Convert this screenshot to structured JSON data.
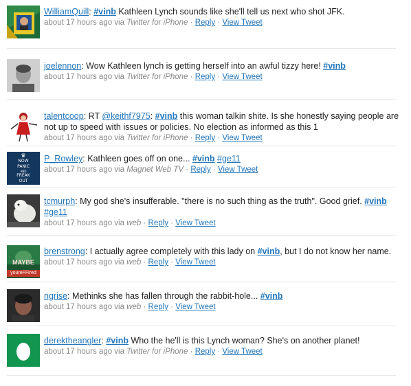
{
  "tweets": [
    {
      "user": "WilliamQuill",
      "parts": [
        {
          "t": "tag",
          "v": "#vinb"
        },
        {
          "t": "text",
          "v": " Kathleen Lynch sounds like she'll tell us next who shot JFK."
        }
      ],
      "time": "about 17 hours ago via ",
      "source": "Twitter for iPhone",
      "source_italic": true,
      "reply": "Reply",
      "view": "View Tweet",
      "avatar_icon": "green-yellow-book-avatar"
    },
    {
      "user": "joelennon",
      "parts": [
        {
          "t": "text",
          "v": "Wow Kathleen lynch is getting herself into an awful tizzy here! "
        },
        {
          "t": "tag",
          "v": "#vinb"
        }
      ],
      "time": "about 17 hours ago via ",
      "source": "Twitter for iPhone",
      "source_italic": true,
      "reply": "Reply",
      "view": "View Tweet",
      "avatar_icon": "grey-portrait-avatar"
    },
    {
      "user": "talentcoop",
      "parts": [
        {
          "t": "text",
          "v": "RT "
        },
        {
          "t": "mention",
          "v": "@keithf7975"
        },
        {
          "t": "text",
          "v": ": "
        },
        {
          "t": "tag",
          "v": "#vinb"
        },
        {
          "t": "text",
          "v": " this woman talkin shite. Is she honestly saying people are not up to speed with issues or policies. No election as informed as this 1"
        }
      ],
      "time": "about 17 hours ago via ",
      "source": "Twitter for iPhone",
      "source_italic": true,
      "reply": "Reply",
      "view": "View Tweet",
      "avatar_icon": "cartoon-woman-avatar"
    },
    {
      "user": "P_Rowley",
      "parts": [
        {
          "t": "text",
          "v": "Kathleen goes off on one... "
        },
        {
          "t": "tag",
          "v": "#vinb"
        },
        {
          "t": "text",
          "v": " "
        },
        {
          "t": "mention",
          "v": "#ge11"
        }
      ],
      "time": "about 17 hours ago via ",
      "source": "Magnet Web TV",
      "source_italic": true,
      "reply": "Reply",
      "view": "View Tweet",
      "avatar_icon": "now-panic-avatar",
      "avatar_text": [
        "NOW",
        "PANIC",
        "AND",
        "FREAK",
        "OUT"
      ]
    },
    {
      "user": "tcmurph",
      "parts": [
        {
          "t": "text",
          "v": "My god she's insufferable. \"there is no such thing as the truth\". Good grief. "
        },
        {
          "t": "tag",
          "v": "#vinb"
        },
        {
          "t": "text",
          "v": " "
        },
        {
          "t": "mention",
          "v": "#ge11"
        }
      ],
      "time": "about 17 hours ago via ",
      "source": "web",
      "source_italic": true,
      "reply": "Reply",
      "view": "View Tweet",
      "avatar_icon": "white-animal-avatar"
    },
    {
      "user": "brenstrong",
      "parts": [
        {
          "t": "text",
          "v": "I actually agree completely with this lady on "
        },
        {
          "t": "tag",
          "v": "#vinb"
        },
        {
          "t": "text",
          "v": ", but I do not know her name."
        }
      ],
      "time": "about 17 hours ago via ",
      "source": "web",
      "source_italic": true,
      "reply": "Reply",
      "view": "View Tweet",
      "avatar_icon": "youre-fired-avatar",
      "avatar_text": [
        "MAYBE",
        "youreFFired"
      ]
    },
    {
      "user": "ngrise",
      "parts": [
        {
          "t": "text",
          "v": "Methinks she has fallen through the rabbit-hole... "
        },
        {
          "t": "tag",
          "v": "#vinb"
        }
      ],
      "time": "about 17 hours ago via ",
      "source": "web",
      "source_italic": true,
      "reply": "Reply",
      "view": "View Tweet",
      "avatar_icon": "dark-portrait-avatar"
    },
    {
      "user": "derektheangler",
      "parts": [
        {
          "t": "tag",
          "v": "#vinb"
        },
        {
          "t": "text",
          "v": " Who the he'll is this Lynch woman? She's on another planet!"
        }
      ],
      "time": "about 17 hours ago via ",
      "source": "Twitter for iPhone",
      "source_italic": true,
      "reply": "Reply",
      "view": "View Tweet",
      "avatar_icon": "egg-avatar"
    }
  ]
}
